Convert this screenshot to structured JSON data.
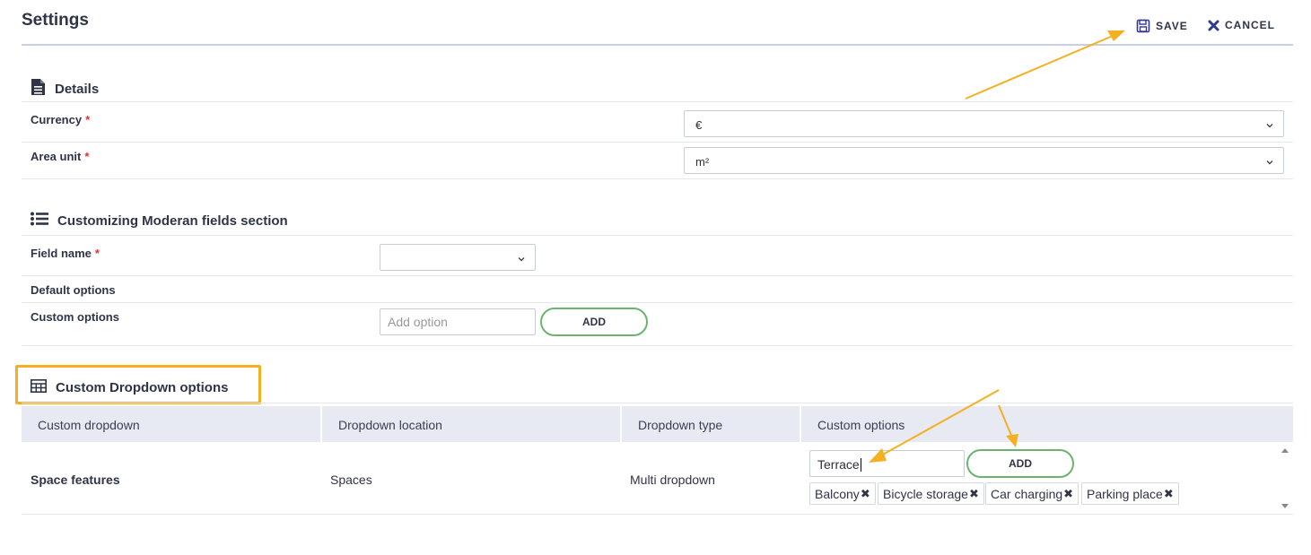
{
  "header": {
    "title": "Settings",
    "save_label": "SAVE",
    "cancel_label": "CANCEL"
  },
  "details": {
    "title": "Details",
    "fields": [
      {
        "label": "Currency",
        "value": "€"
      },
      {
        "label": "Area unit",
        "value": "m²"
      }
    ],
    "required_mark": "*"
  },
  "moderan": {
    "title": "Customizing Moderan fields section",
    "field_name_label": "Field name",
    "field_name_value": "",
    "default_options_label": "Default options",
    "custom_options_label": "Custom options",
    "add_option_placeholder": "Add option",
    "add_label": "ADD"
  },
  "custom_dropdown": {
    "title": "Custom Dropdown options",
    "columns": [
      "Custom dropdown",
      "Dropdown location",
      "Dropdown type",
      "Custom options"
    ],
    "row": {
      "name": "Space features",
      "location": "Spaces",
      "type": "Multi dropdown",
      "input_value": "Terrace",
      "add_label": "ADD",
      "options": [
        "Balcony",
        "Bicycle storage",
        "Car charging",
        "Parking place"
      ]
    },
    "remove_glyph": "✖"
  },
  "colors": {
    "accent": "#2f3a8f",
    "add_border": "#6cb36f",
    "annotation": "#f4b020",
    "required": "#e0303a",
    "table_header_bg": "#e8eaf3"
  }
}
